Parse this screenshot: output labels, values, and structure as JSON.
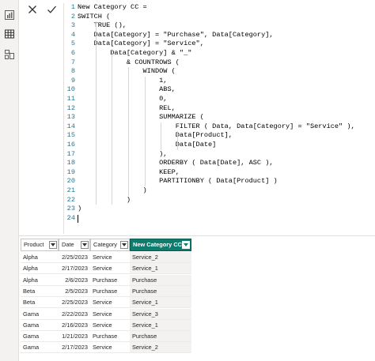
{
  "formula_bar": {
    "cancel_icon": "x-icon",
    "commit_icon": "check-icon",
    "lines": [
      {
        "n": "1",
        "text": "New Category CC ="
      },
      {
        "n": "2",
        "text": "SWITCH ("
      },
      {
        "n": "3",
        "text": "    TRUE (),"
      },
      {
        "n": "4",
        "text": "    Data[Category] = \"Purchase\", Data[Category],"
      },
      {
        "n": "5",
        "text": "    Data[Category] = \"Service\","
      },
      {
        "n": "6",
        "text": "        Data[Category] & \"_\""
      },
      {
        "n": "7",
        "text": "            & COUNTROWS ("
      },
      {
        "n": "8",
        "text": "                WINDOW ("
      },
      {
        "n": "9",
        "text": "                    1,"
      },
      {
        "n": "10",
        "text": "                    ABS,"
      },
      {
        "n": "11",
        "text": "                    0,"
      },
      {
        "n": "12",
        "text": "                    REL,"
      },
      {
        "n": "13",
        "text": "                    SUMMARIZE ("
      },
      {
        "n": "14",
        "text": "                        FILTER ( Data, Data[Category] = \"Service\" ),"
      },
      {
        "n": "15",
        "text": "                        Data[Product],"
      },
      {
        "n": "16",
        "text": "                        Data[Date]"
      },
      {
        "n": "17",
        "text": "                    ),"
      },
      {
        "n": "18",
        "text": "                    ORDERBY ( Data[Date], ASC ),"
      },
      {
        "n": "19",
        "text": "                    KEEP,"
      },
      {
        "n": "20",
        "text": "                    PARTITIONBY ( Data[Product] )"
      },
      {
        "n": "21",
        "text": "                )"
      },
      {
        "n": "22",
        "text": "            )"
      },
      {
        "n": "23",
        "text": ")"
      },
      {
        "n": "24",
        "text": ""
      }
    ]
  },
  "left_rail": {
    "icons": [
      "report-view-icon",
      "table-view-icon",
      "model-view-icon"
    ]
  },
  "table": {
    "columns": [
      "Product",
      "Date",
      "Category",
      "New Category CC"
    ],
    "selected_column": "New Category CC",
    "rows": [
      [
        "Alpha",
        "2/25/2023",
        "Service",
        "Service_2"
      ],
      [
        "Alpha",
        "2/17/2023",
        "Service",
        "Service_1"
      ],
      [
        "Alpha",
        "2/6/2023",
        "Purchase",
        "Purchase"
      ],
      [
        "Beta",
        "2/5/2023",
        "Purchase",
        "Purchase"
      ],
      [
        "Beta",
        "2/25/2023",
        "Service",
        "Service_1"
      ],
      [
        "Gama",
        "2/22/2023",
        "Service",
        "Service_3"
      ],
      [
        "Gama",
        "2/16/2023",
        "Service",
        "Service_1"
      ],
      [
        "Gama",
        "1/21/2023",
        "Purchase",
        "Purchase"
      ],
      [
        "Gama",
        "2/17/2023",
        "Service",
        "Service_2"
      ]
    ]
  },
  "colors": {
    "selected_header": "#107c6e",
    "line_number": "#237893"
  }
}
